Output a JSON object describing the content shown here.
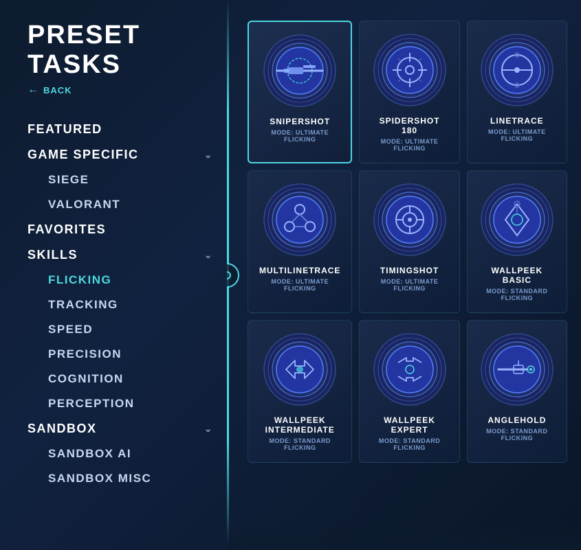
{
  "page": {
    "title": "PRESET TASKS",
    "back_label": "BACK"
  },
  "sidebar": {
    "items": [
      {
        "id": "featured",
        "label": "FEATURED",
        "level": 0,
        "has_chevron": false,
        "active": false
      },
      {
        "id": "game-specific",
        "label": "GAME SPECIFIC",
        "level": 0,
        "has_chevron": true,
        "active": false
      },
      {
        "id": "siege",
        "label": "SIEGE",
        "level": 1,
        "has_chevron": false,
        "active": false
      },
      {
        "id": "valorant",
        "label": "VALORANT",
        "level": 1,
        "has_chevron": false,
        "active": false
      },
      {
        "id": "favorites",
        "label": "FAVORITES",
        "level": 0,
        "has_chevron": false,
        "active": false
      },
      {
        "id": "skills",
        "label": "SKILLS",
        "level": 0,
        "has_chevron": true,
        "active": false
      },
      {
        "id": "flicking",
        "label": "FLICKING",
        "level": 1,
        "has_chevron": false,
        "active": true
      },
      {
        "id": "tracking",
        "label": "TRACKING",
        "level": 1,
        "has_chevron": false,
        "active": false
      },
      {
        "id": "speed",
        "label": "SPEED",
        "level": 1,
        "has_chevron": false,
        "active": false
      },
      {
        "id": "precision",
        "label": "PRECISION",
        "level": 1,
        "has_chevron": false,
        "active": false
      },
      {
        "id": "cognition",
        "label": "COGNITION",
        "level": 1,
        "has_chevron": false,
        "active": false
      },
      {
        "id": "perception",
        "label": "PERCEPTION",
        "level": 1,
        "has_chevron": false,
        "active": false
      },
      {
        "id": "sandbox",
        "label": "SANDBOX",
        "level": 0,
        "has_chevron": true,
        "active": false
      },
      {
        "id": "sandbox-ai",
        "label": "SANDBOX AI",
        "level": 1,
        "has_chevron": false,
        "active": false
      },
      {
        "id": "sandbox-misc",
        "label": "SANDBOX MISC",
        "level": 1,
        "has_chevron": false,
        "active": false
      }
    ]
  },
  "cards": [
    {
      "id": "snipershot",
      "name": "SNIPERSHOT",
      "mode_label": "MODE: ULTIMATE",
      "mode_value": "FLICKING",
      "icon_type": "sniper",
      "selected": true
    },
    {
      "id": "spidershot-180",
      "name": "SPIDERSHOT 180",
      "mode_label": "MODE: ULTIMATE",
      "mode_value": "FLICKING",
      "icon_type": "crosshair",
      "selected": false
    },
    {
      "id": "linetrace",
      "name": "LINETRACE",
      "mode_label": "MODE: ULTIMATE",
      "mode_value": "FLICKING",
      "icon_type": "circle-slash",
      "selected": false
    },
    {
      "id": "multilinetrace",
      "name": "MULTILINETRACE",
      "mode_label": "MODE: ULTIMATE",
      "mode_value": "FLICKING",
      "icon_type": "triangle",
      "selected": false
    },
    {
      "id": "timingshot",
      "name": "TIMINGSHOT",
      "mode_label": "MODE: ULTIMATE",
      "mode_value": "FLICKING",
      "icon_type": "target",
      "selected": false
    },
    {
      "id": "wallpeek-basic",
      "name": "WALLPEEK BASIC",
      "mode_label": "MODE: STANDARD",
      "mode_value": "FLICKING",
      "icon_type": "diamond",
      "selected": false
    },
    {
      "id": "wallpeek-intermediate",
      "name": "WALLPEEK INTERMEDIATE",
      "mode_label": "MODE: STANDARD",
      "mode_value": "FLICKING",
      "icon_type": "arrows",
      "selected": false
    },
    {
      "id": "wallpeek-expert",
      "name": "WALLPEEK EXPERT",
      "mode_label": "MODE: STANDARD",
      "mode_value": "FLICKING",
      "icon_type": "arrows2",
      "selected": false
    },
    {
      "id": "anglehold",
      "name": "ANGLEHOLD",
      "mode_label": "MODE: STANDARD",
      "mode_value": "FLICKING",
      "icon_type": "gun",
      "selected": false
    }
  ],
  "colors": {
    "accent": "#4dd9e0",
    "active_text": "#4dd9e0",
    "nav_text": "#ffffff",
    "sub_text": "#c8d8f0",
    "mode_text": "#7a9bcc",
    "bg_dark": "#0d1b2e",
    "card_bg": "#1a2a4a"
  }
}
